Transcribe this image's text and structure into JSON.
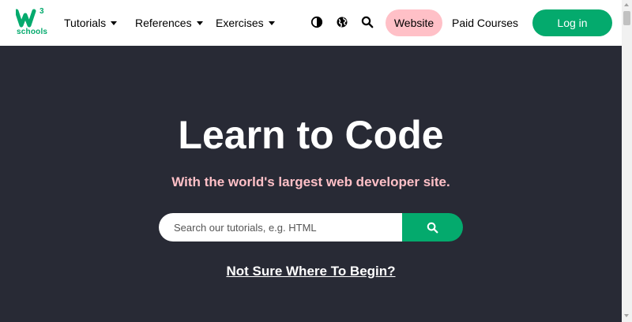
{
  "brand": {
    "name": "schools",
    "superscript": "3",
    "color": "#04AA6D"
  },
  "nav": {
    "items": [
      {
        "label": "Tutorials",
        "has_dropdown": true
      },
      {
        "label": "References",
        "has_dropdown": true
      },
      {
        "label": "Exercises",
        "has_dropdown": true
      }
    ],
    "icons": [
      "contrast-icon",
      "globe-icon",
      "search-icon"
    ],
    "website_label": "Website",
    "paid_courses_label": "Paid Courses",
    "login_label": "Log in"
  },
  "hero": {
    "title": "Learn to Code",
    "subtitle": "With the world's largest web developer site.",
    "search": {
      "placeholder": "Search our tutorials, e.g. HTML",
      "value": ""
    },
    "cta_link": "Not Sure Where To Begin?"
  },
  "colors": {
    "accent_green": "#04AA6D",
    "pink": "#FFC0C7",
    "hero_background": "#282A35",
    "nav_background": "#FFFFFF"
  }
}
